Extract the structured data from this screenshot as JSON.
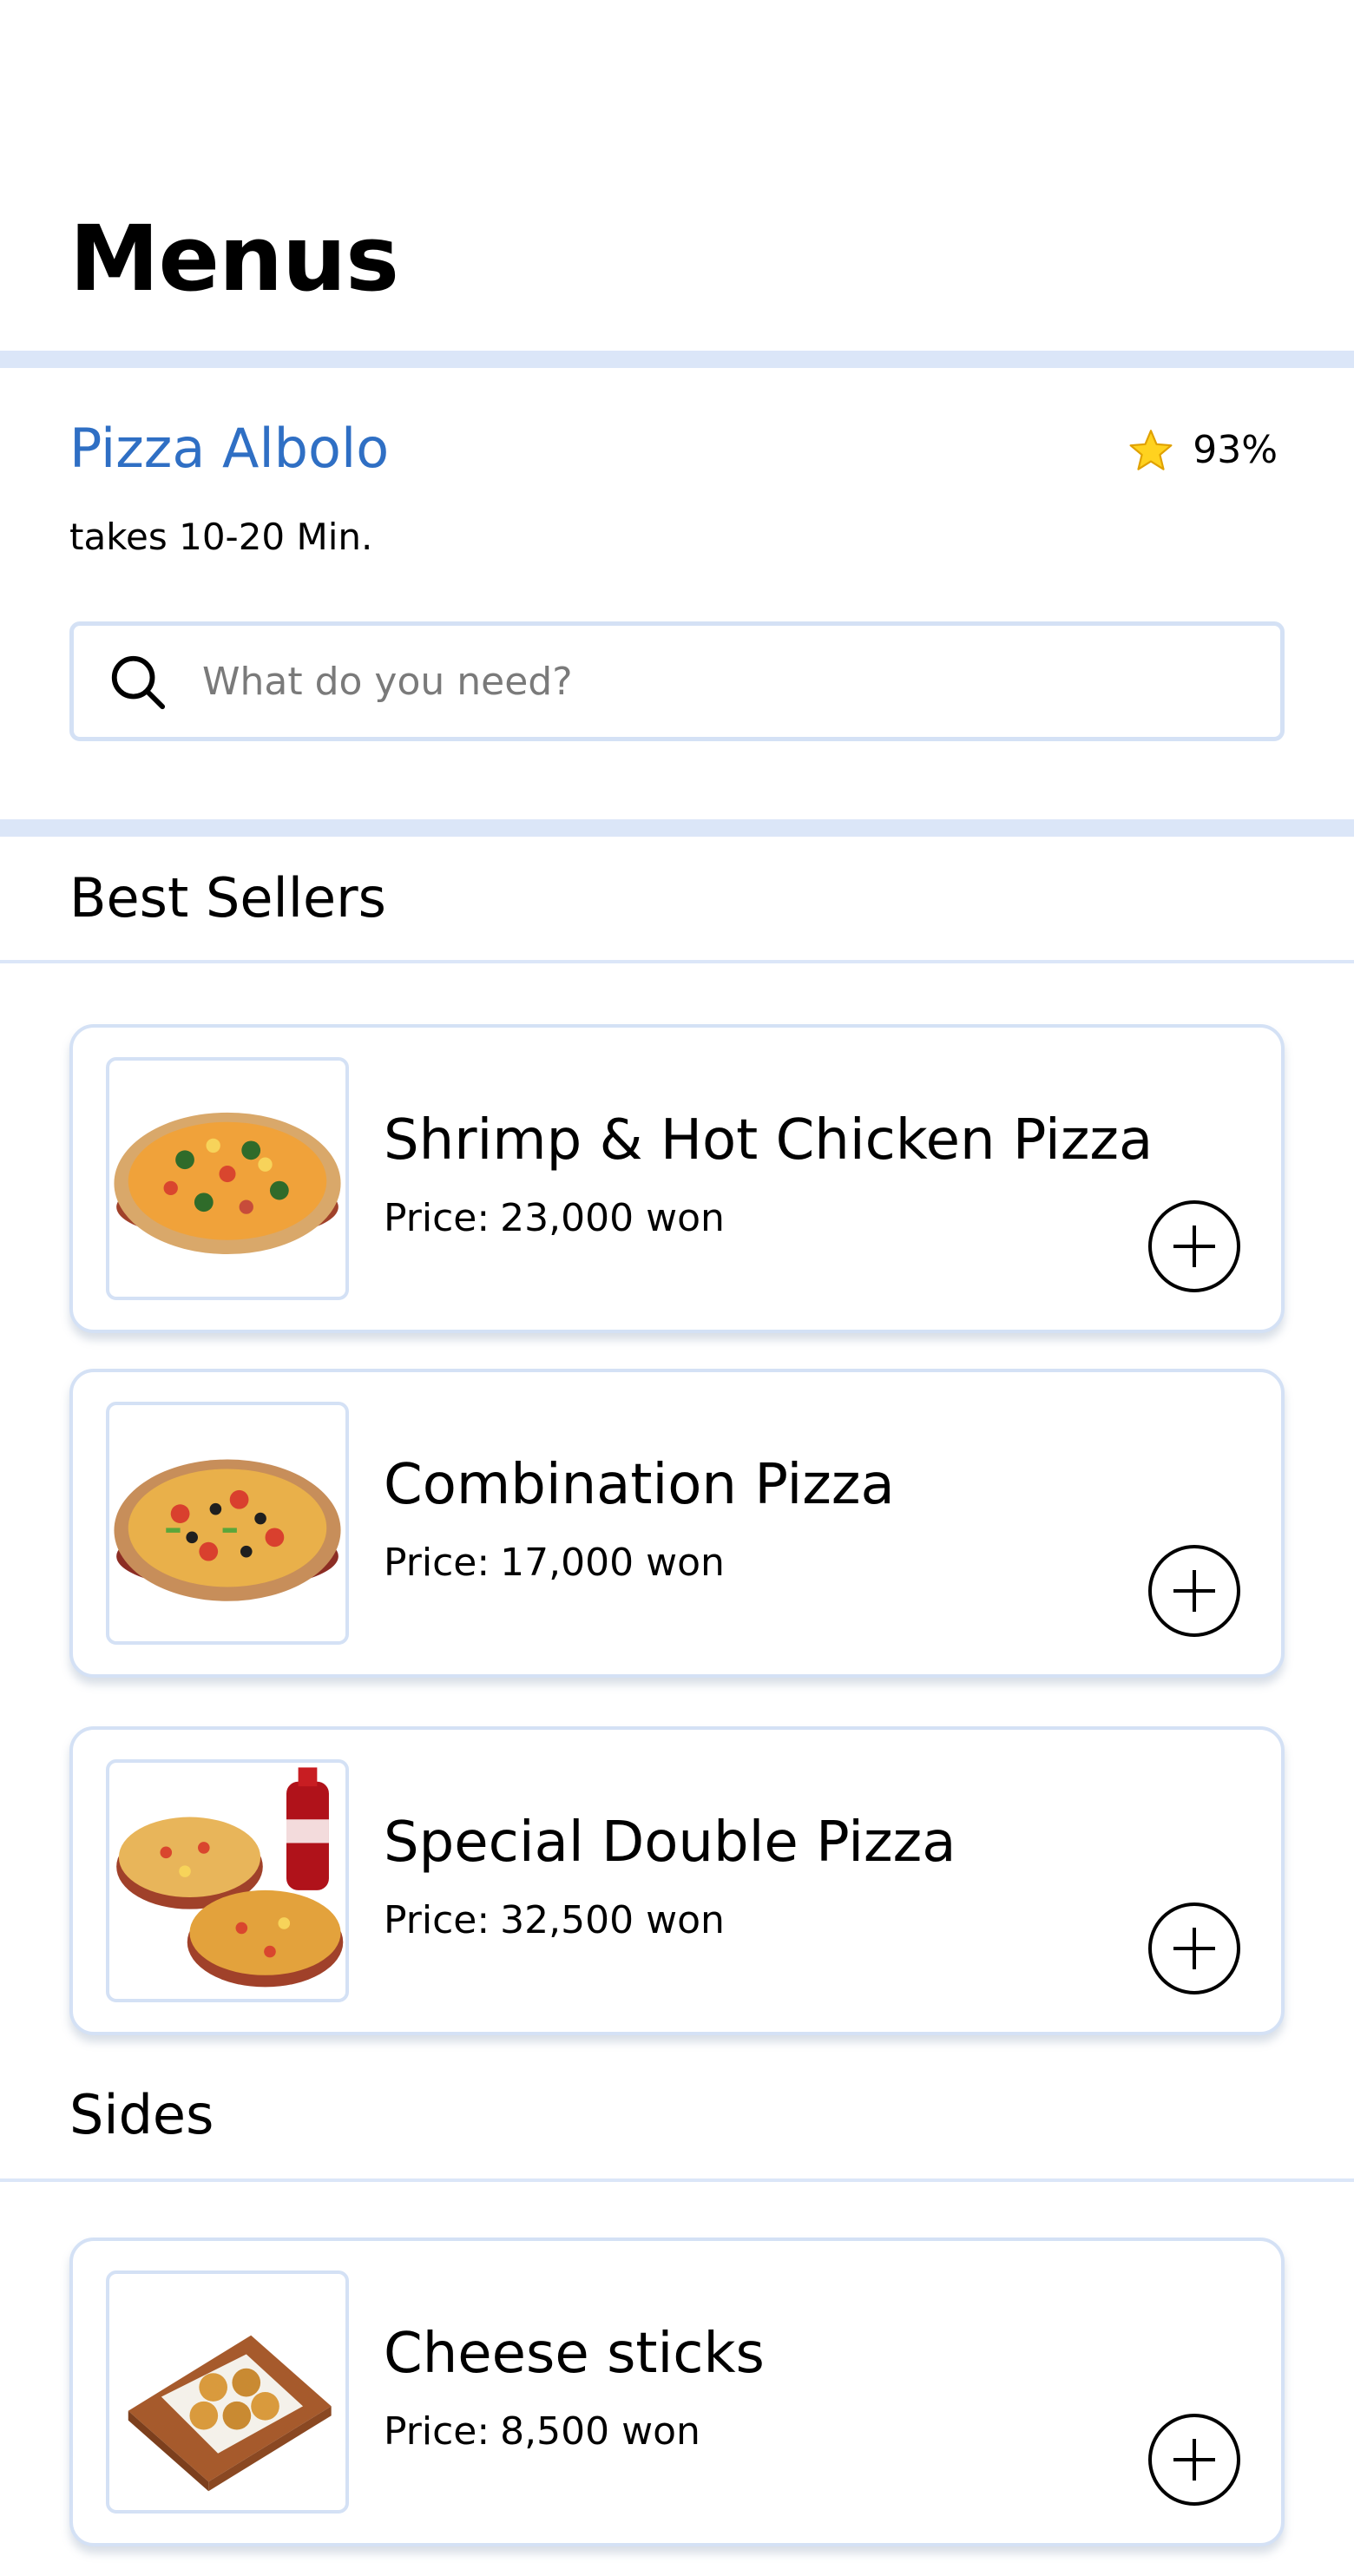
{
  "header": {
    "title": "Menus"
  },
  "restaurant": {
    "name": "Pizza Albolo",
    "rating": "93%",
    "rating_icon": "star-icon",
    "eta": "takes 10-20 Min."
  },
  "search": {
    "icon": "search-icon",
    "placeholder": "What do you need?",
    "value": ""
  },
  "sections": [
    {
      "title": "Best Sellers",
      "items": [
        {
          "name": "Shrimp & Hot Chicken Pizza",
          "price_label": "Price:",
          "price": "23,000 won",
          "image": "shrimp-hot-chicken-pizza-image",
          "add_icon": "plus-circle-icon"
        },
        {
          "name": "Combination Pizza",
          "price_label": "Price:",
          "price": "17,000 won",
          "image": "combination-pizza-image",
          "add_icon": "plus-circle-icon"
        },
        {
          "name": "Special Double Pizza",
          "price_label": "Price:",
          "price": "32,500 won",
          "image": "special-double-pizza-with-cola-image",
          "add_icon": "plus-circle-icon"
        }
      ]
    },
    {
      "title": "Sides",
      "items": [
        {
          "name": "Cheese sticks",
          "price_label": "Price:",
          "price": "8,500 won",
          "image": "cheese-sticks-image",
          "add_icon": "plus-circle-icon"
        }
      ]
    }
  ],
  "colors": {
    "accent": "#2f6fc4",
    "divider": "#dbe6f8",
    "border": "#d4e1f5",
    "star": "#f5b800"
  }
}
